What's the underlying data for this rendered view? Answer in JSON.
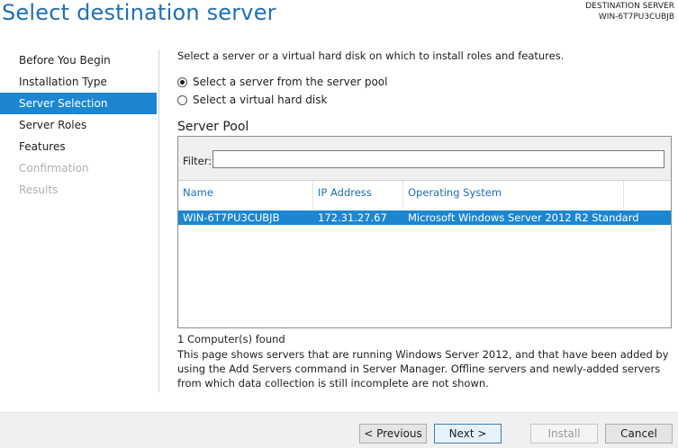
{
  "header": {
    "title": "Select destination server",
    "dest_label": "DESTINATION SERVER",
    "dest_server": "WIN-6T7PU3CUBJB"
  },
  "sidebar": {
    "items": [
      {
        "label": "Before You Begin",
        "state": "normal"
      },
      {
        "label": "Installation Type",
        "state": "normal"
      },
      {
        "label": "Server Selection",
        "state": "active"
      },
      {
        "label": "Server Roles",
        "state": "normal"
      },
      {
        "label": "Features",
        "state": "normal"
      },
      {
        "label": "Confirmation",
        "state": "disabled"
      },
      {
        "label": "Results",
        "state": "disabled"
      }
    ]
  },
  "main": {
    "intro": "Select a server or a virtual hard disk on which to install roles and features.",
    "options": [
      {
        "label": "Select a server from the server pool",
        "checked": true
      },
      {
        "label": "Select a virtual hard disk",
        "checked": false
      }
    ],
    "pool_heading": "Server Pool",
    "filter_label": "Filter:",
    "filter_value": "",
    "columns": [
      "Name",
      "IP Address",
      "Operating System"
    ],
    "rows": [
      {
        "name": "WIN-6T7PU3CUBJB",
        "ip": "172.31.27.67",
        "os": "Microsoft Windows Server 2012 R2 Standard",
        "selected": true
      }
    ],
    "found": "1 Computer(s) found",
    "description": "This page shows servers that are running Windows Server 2012, and that have been added by using the Add Servers command in Server Manager. Offline servers and newly-added servers from which data collection is still incomplete are not shown."
  },
  "footer": {
    "previous": "< Previous",
    "next": "Next >",
    "install": "Install",
    "cancel": "Cancel"
  },
  "colors": {
    "accent": "#1f6fb3",
    "selection": "#1c86d1"
  }
}
